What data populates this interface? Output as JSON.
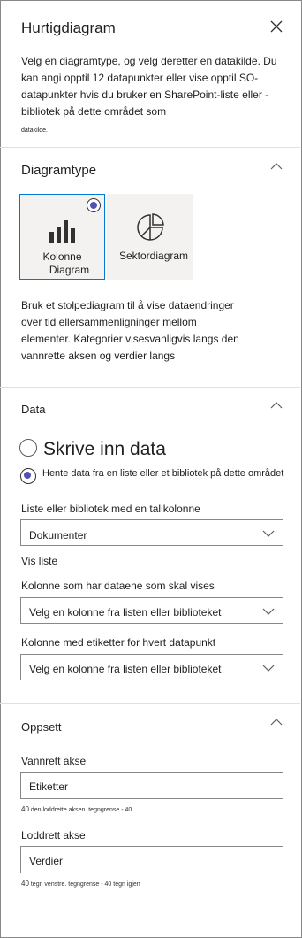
{
  "panel": {
    "title": "Hurtigdiagram",
    "intro": "Velg en diagramtype, og velg deretter en datakilde. Du kan angi opptil 12 datapunkter eller vise opptil SO-datapunkter hvis du bruker en SharePoint-liste eller -bibliotek på dette området som",
    "intro_tail": "datakilde."
  },
  "chart_type": {
    "heading": "Diagramtype",
    "options": [
      {
        "label_line1": "Kolonne",
        "label_line2": "Diagram",
        "icon": "column-chart-icon",
        "selected": true
      },
      {
        "label": "Sektordiagram",
        "icon": "pie-chart-icon",
        "selected": false
      }
    ],
    "description": "Bruk et stolpediagram til å vise dataendringer over tid ellersammenligninger mellom elementer. Kategorier visesvanligvis langs den vannrette aksen og verdier langs"
  },
  "data": {
    "heading": "Data",
    "radio_manual": "Skrive inn data",
    "radio_list": "Hente data fra en liste eller et bibliotek på dette området",
    "list_label": "Liste eller bibliotek med en tallkolonne",
    "list_value": "Dokumenter",
    "view_label": "Vis liste",
    "value_column_label": "Kolonne som har dataene som skal vises",
    "value_column_value": "Velg en kolonne fra listen eller biblioteket",
    "label_column_label": "Kolonne med etiketter for hvert datapunkt",
    "label_column_value": "Velg en kolonne fra listen eller biblioteket"
  },
  "layout": {
    "heading": "Oppsett",
    "x_label": "Vannrett akse",
    "x_value": "Etiketter",
    "x_hint_num": "40",
    "x_hint": "den loddrette aksen. tegngrense - 40",
    "y_label": "Loddrett akse",
    "y_value": "Verdier",
    "y_hint_num": "40",
    "y_hint": "tegn venstre. tegngrense - 40 tegn igjen"
  },
  "colors": {
    "accent": "#4f52b2",
    "border": "#8a8886",
    "text": "#201f1e",
    "tile": "#f3f2f1"
  }
}
